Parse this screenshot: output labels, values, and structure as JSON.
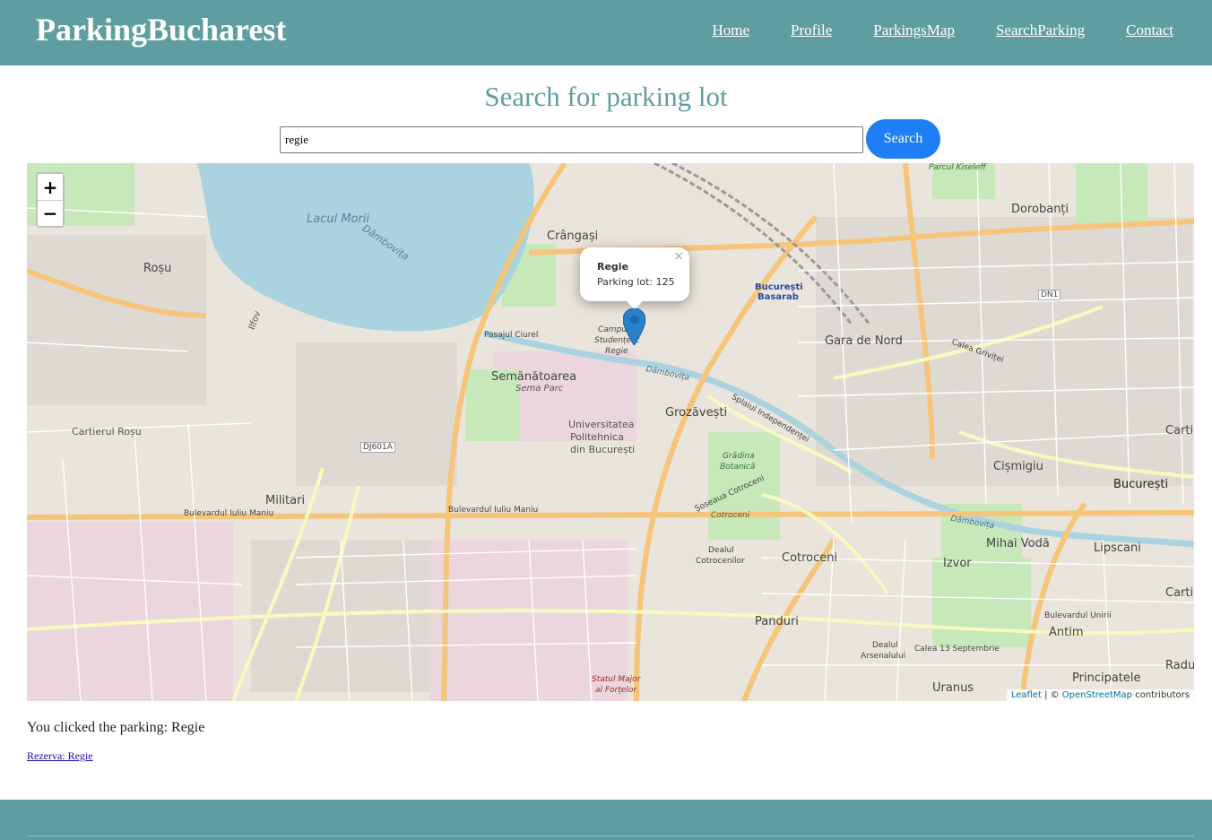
{
  "header": {
    "brand": "ParkingBucharest",
    "nav": [
      "Home",
      "Profile",
      "ParkingsMap",
      "SearchParking",
      "Contact"
    ]
  },
  "page": {
    "title": "Search for parking lot"
  },
  "search": {
    "value": "regie",
    "button_label": "Search"
  },
  "map": {
    "zoom_in": "+",
    "zoom_out": "−",
    "popup": {
      "title": "Regie",
      "text": "Parking lot: 125",
      "close": "×"
    },
    "attribution": {
      "leaflet": "Leaflet",
      "separator": " | © ",
      "osm": "OpenStreetMap",
      "suffix": " contributors"
    },
    "labels": {
      "lake": "Lacul Morii",
      "river_lake": "Dâmbovița",
      "crangasi": "Crângași",
      "rosu": "Roșu",
      "cartierul_rosu": "Cartierul Roșu",
      "militari": "Militari",
      "semanatoarea": "Semănătoarea",
      "sema_parc": "Sema Parc",
      "universitatea": "Universitatea",
      "politehnica": "Politehnica",
      "din_bucuresti": "din București",
      "grozavesti": "Grozăvești",
      "gara_de_nord": "Gara de Nord",
      "bucuresti_basarab_1": "București",
      "bucuresti_basarab_2": "Basarab",
      "dorobanti": "Dorobanți",
      "cismigiu": "Cișmigiu",
      "bucuresti": "București",
      "cotroceni": "Cotroceni",
      "panduri": "Panduri",
      "izvor": "Izvor",
      "mihai_voda": "Mihai Vodă",
      "lipscani": "Lipscani",
      "antim": "Antim",
      "principatele": "Principatele",
      "uranus": "Uranus",
      "radu_voda": "Radu Vo",
      "cartier_1": "Cartier",
      "cartier_2": "Cartier",
      "bulevardul_iuliu_maniu_1": "Bulevardul Iuliu Maniu",
      "bulevardul_iuliu_maniu_2": "Bulevardul Iuliu Maniu",
      "dambovita_river": "Dâmbovița",
      "dambovita_river_2": "Dâmbovița",
      "pasajul_ciurel": "Pasajul Ciurel",
      "dj601a": "DJ601A",
      "dn1": "DN1",
      "calea_grivitei": "Calea Griviței",
      "splaiul_independentei": "Splaiul Independenței",
      "soseaua_cotroceni": "Șoseaua Cotroceni",
      "bulevardul_unirii": "Bulevardul Unirii",
      "calea_13_septembrie": "Calea 13 Septembrie",
      "parcul_kiseleff": "Parcul Kiseleff",
      "campus_1": "Campus",
      "campus_2": "Studențesc",
      "campus_3": "Regie",
      "gradina_1": "Grădina",
      "gradina_2": "Botanică",
      "dealul_arsenalului_1": "Dealul",
      "dealul_arsenalului_2": "Arsenalului",
      "statul_major_1": "Statul Major",
      "statul_major_2": "al Forțelor",
      "dealul_cotrocenilor_1": "Dealul",
      "dealul_cotrocenilor_2": "Cotrocenilor",
      "cotroceni_small": "Cotroceni",
      "ilfov": "Ilfov"
    }
  },
  "result": {
    "clicked_text": "You clicked the parking: Regie",
    "reserve_link": "Rezerva: Regie"
  }
}
